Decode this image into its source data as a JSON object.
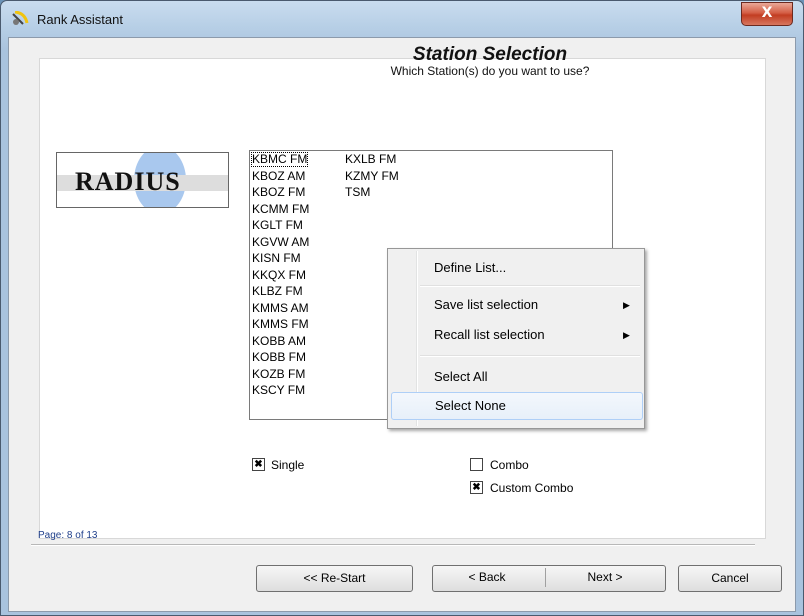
{
  "window": {
    "title": "Rank Assistant",
    "close_glyph": "X",
    "icon": "satellite-dish-icon"
  },
  "header": {
    "title": "Station Selection",
    "subtitle": "Which Station(s) do you want to use?"
  },
  "logo": {
    "text": "RADIUS"
  },
  "stations": {
    "column1": [
      "KBMC FM",
      "KBOZ AM",
      "KBOZ FM",
      "KCMM FM",
      "KGLT FM",
      "KGVW AM",
      "KISN FM",
      "KKQX FM",
      "KLBZ FM",
      "KMMS AM",
      "KMMS FM",
      "KOBB AM",
      "KOBB FM",
      "KOZB FM",
      "KSCY FM"
    ],
    "column2": [
      "KXLB FM",
      "KZMY FM",
      "TSM"
    ]
  },
  "context_menu": {
    "items": [
      {
        "label": "Define List...",
        "submenu": false
      },
      {
        "label": "Save list selection",
        "submenu": true
      },
      {
        "label": "Recall list selection",
        "submenu": true
      },
      {
        "label": "Select All",
        "submenu": false
      },
      {
        "label": "Select None",
        "submenu": false,
        "highlighted": true
      }
    ],
    "submenu_glyph": "▶"
  },
  "options": {
    "single": {
      "label": "Single",
      "checked": true
    },
    "combo": {
      "label": "Combo",
      "checked": false
    },
    "custom_combo": {
      "label": "Custom Combo",
      "checked": true
    },
    "check_glyph": "✖"
  },
  "footer": {
    "page_label": "Page: 8 of 13",
    "restart": "<< Re-Start",
    "back": "< Back",
    "next": "Next >",
    "cancel": "Cancel"
  }
}
